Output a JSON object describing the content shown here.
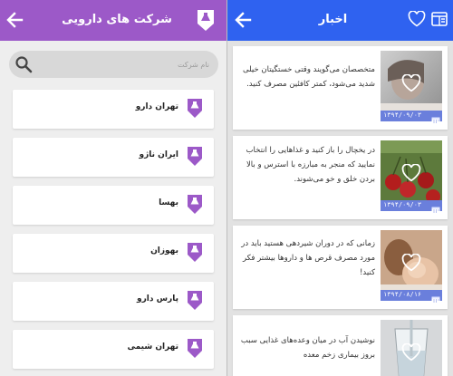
{
  "companies_screen": {
    "title": "شرکت های دارویی",
    "search_placeholder": "نام شرکت",
    "companies": [
      {
        "name": "تهران دارو"
      },
      {
        "name": "ایران ناژو"
      },
      {
        "name": "بهسا"
      },
      {
        "name": "بهوزان"
      },
      {
        "name": "پارس دارو"
      },
      {
        "name": "تهران شیمی"
      }
    ]
  },
  "news_screen": {
    "title": "اخبار",
    "items": [
      {
        "text": "متخصصان می‌گویند وقتی خستگیتان خیلی شدید می‌شود، کمتر کافئین مصرف کنید.",
        "date": "۱۳۹۴/۰۹/۰۳",
        "image": "tired-woman-photo"
      },
      {
        "text": "در یخچال را باز کنید و غذاهایی را انتخاب نمایید که منجر به مبارزه با استرس و بالا بردن خلق و خو می‌شوند.",
        "date": "۱۳۹۴/۰۹/۰۳",
        "image": "cherries-photo"
      },
      {
        "text": "زمانی که در دوران شیردهی هستید باید در مورد مصرف قرص ها و داروها بیشتر فکر کنید!",
        "date": "۱۳۹۴/۰۸/۱۶",
        "image": "mother-baby-photo"
      },
      {
        "text": "نوشیدن آب در میان وعده‌های غذایی سبب بروز بیماری زخم معده",
        "date": "",
        "image": "water-glass-photo"
      }
    ]
  },
  "colors": {
    "purple": "#9c59c8",
    "blue": "#2f62f0",
    "date_bar": "#6a7fdc"
  }
}
